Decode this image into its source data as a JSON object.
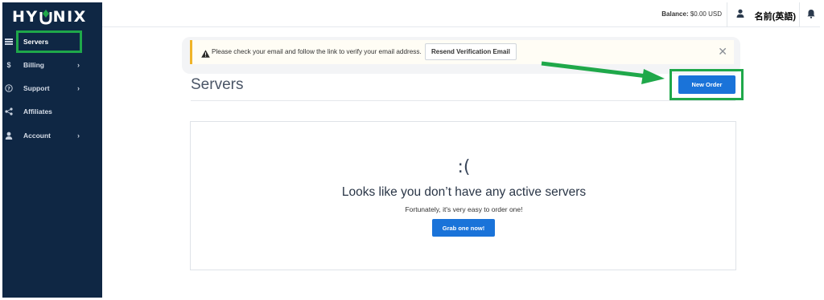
{
  "brand": {
    "logo_text_left": "HY",
    "logo_text_right": "NIX"
  },
  "sidebar": {
    "items": [
      {
        "label": "Servers",
        "icon": "server-icon",
        "has_chevron": false,
        "active": true
      },
      {
        "label": "Billing",
        "icon": "dollar-icon",
        "has_chevron": true
      },
      {
        "label": "Support",
        "icon": "question-circle-icon",
        "has_chevron": true
      },
      {
        "label": "Affiliates",
        "icon": "share-icon",
        "has_chevron": false
      },
      {
        "label": "Account",
        "icon": "user-icon",
        "has_chevron": true
      }
    ]
  },
  "topbar": {
    "balance_label": "Balance:",
    "balance_value": "$0.00 USD",
    "user_name": "名前(英語)"
  },
  "alert": {
    "message": "Please check your email and follow the link to verify your email address.",
    "resend_label": "Resend Verification Email",
    "close_glyph": "✕"
  },
  "page": {
    "title": "Servers",
    "new_order_label": "New Order"
  },
  "empty_state": {
    "face": ":(",
    "title": "Looks like you don’t have any active servers",
    "subtitle": "Fortunately, it's very easy to order one!",
    "cta_label": "Grab one now!"
  },
  "colors": {
    "sidebar_bg": "#0f2744",
    "primary": "#1a73d9",
    "annotation_green": "#1fa84a",
    "alert_accent": "#f0b429"
  }
}
